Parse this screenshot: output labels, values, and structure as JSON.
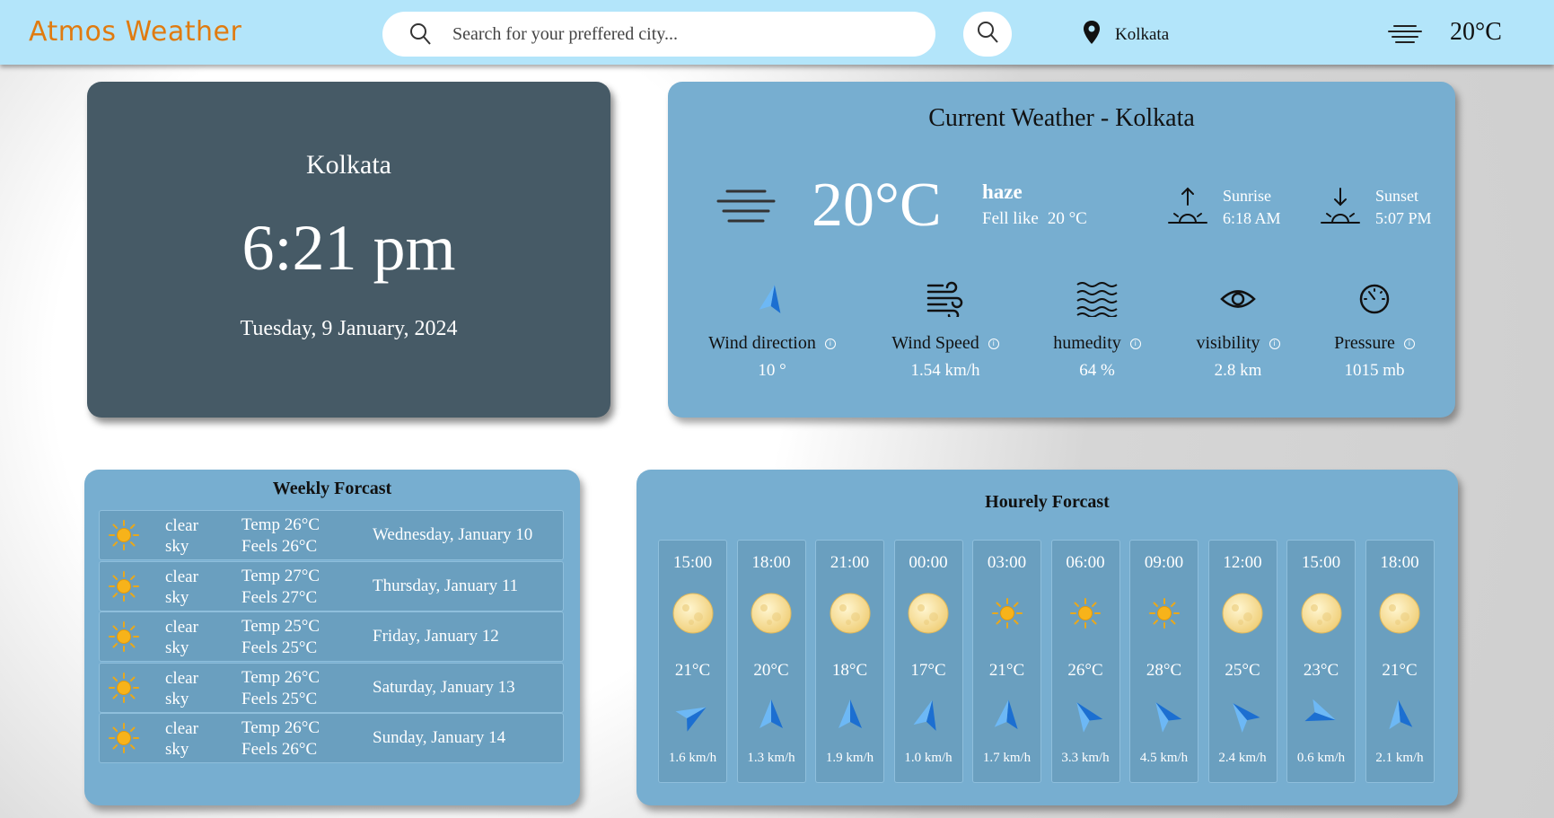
{
  "header": {
    "brand": "Atmos Weather",
    "search_placeholder": "Search for your preffered city...",
    "location": "Kolkata",
    "temp": "20°C"
  },
  "clock": {
    "city": "Kolkata",
    "time": "6:21 pm",
    "date": "Tuesday, 9 January, 2024"
  },
  "current": {
    "title": "Current Weather - Kolkata",
    "temp": "20°C",
    "description": "haze",
    "feels_label": "Fell like",
    "feels_value": "20 °C",
    "sunrise_label": "Sunrise",
    "sunrise_time": "6:18 AM",
    "sunset_label": "Sunset",
    "sunset_time": "5:07 PM",
    "metrics": [
      {
        "label": "Wind direction",
        "value": "10 °",
        "icon": "wind-arrow-icon"
      },
      {
        "label": "Wind Speed",
        "value": "1.54 km/h",
        "icon": "wind-icon"
      },
      {
        "label": "humedity",
        "value": "64 %",
        "icon": "waves-icon"
      },
      {
        "label": "visibility",
        "value": "2.8 km",
        "icon": "eye-icon"
      },
      {
        "label": "Pressure",
        "value": "1015 mb",
        "icon": "gauge-icon"
      }
    ]
  },
  "weekly": {
    "title": "Weekly Forcast",
    "days": [
      {
        "desc": "clear sky",
        "temp": "Temp 26°C",
        "feels": "Feels 26°C",
        "day": "Wednesday, January 10"
      },
      {
        "desc": "clear sky",
        "temp": "Temp 27°C",
        "feels": "Feels 27°C",
        "day": "Thursday, January 11"
      },
      {
        "desc": "clear sky",
        "temp": "Temp 25°C",
        "feels": "Feels 25°C",
        "day": "Friday, January 12"
      },
      {
        "desc": "clear sky",
        "temp": "Temp 26°C",
        "feels": "Feels 25°C",
        "day": "Saturday, January 13"
      },
      {
        "desc": "clear sky",
        "temp": "Temp 26°C",
        "feels": "Feels 26°C",
        "day": "Sunday, January 14"
      }
    ]
  },
  "hourly": {
    "title": "Hourely Forcast",
    "hours": [
      {
        "time": "15:00",
        "icon": "moon",
        "temp": "21°C",
        "wind": "1.6 km/h",
        "wind_deg": 60
      },
      {
        "time": "18:00",
        "icon": "moon",
        "temp": "20°C",
        "wind": "1.3 km/h",
        "wind_deg": 0
      },
      {
        "time": "21:00",
        "icon": "moon",
        "temp": "18°C",
        "wind": "1.9 km/h",
        "wind_deg": 0
      },
      {
        "time": "00:00",
        "icon": "moon",
        "temp": "17°C",
        "wind": "1.0 km/h",
        "wind_deg": 15
      },
      {
        "time": "03:00",
        "icon": "sun",
        "temp": "21°C",
        "wind": "1.7 km/h",
        "wind_deg": 5
      },
      {
        "time": "06:00",
        "icon": "sun",
        "temp": "26°C",
        "wind": "3.3 km/h",
        "wind_deg": 325
      },
      {
        "time": "09:00",
        "icon": "sun",
        "temp": "28°C",
        "wind": "4.5 km/h",
        "wind_deg": 325
      },
      {
        "time": "12:00",
        "icon": "moon",
        "temp": "25°C",
        "wind": "2.4 km/h",
        "wind_deg": 320
      },
      {
        "time": "15:00",
        "icon": "moon",
        "temp": "23°C",
        "wind": "0.6 km/h",
        "wind_deg": 110
      },
      {
        "time": "18:00",
        "icon": "moon",
        "temp": "21°C",
        "wind": "2.1 km/h",
        "wind_deg": 355
      }
    ]
  },
  "colors": {
    "header_bg": "#b3e5fa",
    "brand": "#e07b10",
    "clock_card": "#465a66",
    "card": "#77aed0",
    "row": "#6a9fbf",
    "arrow": "#2f8fe8"
  }
}
